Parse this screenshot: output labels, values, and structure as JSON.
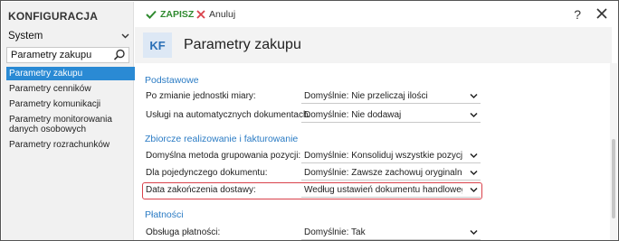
{
  "app": {
    "title": "KONFIGURACJA"
  },
  "sidebar": {
    "module_select": "System",
    "search_value": "Parametry zakupu",
    "items": [
      {
        "label": "Parametry zakupu",
        "active": true
      },
      {
        "label": "Parametry cenników"
      },
      {
        "label": "Parametry komunikacji"
      },
      {
        "label": "Parametry monitorowania danych osobowych"
      },
      {
        "label": "Parametry rozrachunków"
      }
    ]
  },
  "toolbar": {
    "save_label": "ZAPISZ",
    "cancel_label": "Anuluj",
    "help_label": "?"
  },
  "header": {
    "badge": "KF",
    "title": "Parametry zakupu"
  },
  "sections": [
    {
      "title": "Podstawowe",
      "rows": [
        {
          "label": "Po zmianie jednostki miary:",
          "value": "Domyślnie: Nie przeliczaj ilości"
        },
        {
          "label": "Usługi na automatycznych dokumentach:",
          "value": "Domyślnie: Nie dodawaj"
        }
      ]
    },
    {
      "title": "Zbiorcze realizowanie i fakturowanie",
      "rows": [
        {
          "label": "Domyślna metoda grupowania pozycji:",
          "value": "Domyślnie: Konsoliduj wszystkie pozycje do j..."
        },
        {
          "label": "Dla pojedynczego dokumentu:",
          "value": "Domyślnie: Zawsze zachowuj oryginalne poz..."
        },
        {
          "label": "Data zakończenia dostawy:",
          "value": "Według ustawień dokumentu handlowego",
          "highlighted": true
        }
      ]
    },
    {
      "title": "Płatności",
      "rows": [
        {
          "label": "Obsługa płatności:",
          "value": "Domyślnie: Tak"
        }
      ]
    }
  ],
  "colors": {
    "accent": "#2a8ad4",
    "section_title": "#2a7bc4",
    "save_green": "#2f8a2f",
    "cancel_red": "#d9414a",
    "highlight_border": "#d9414a"
  }
}
